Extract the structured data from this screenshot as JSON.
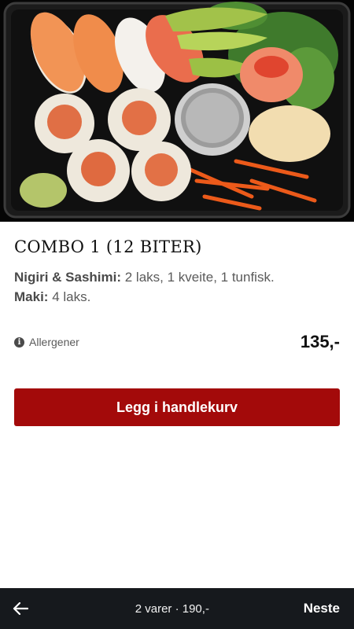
{
  "product": {
    "title": "COMBO 1 (12 BITER)",
    "desc": [
      {
        "label": "Nigiri & Sashimi:",
        "text": " 2 laks, 1 kveite, 1 tunfisk."
      },
      {
        "label": "Maki:",
        "text": " 4 laks."
      }
    ],
    "allergen_label": "Allergener",
    "price": "135,-"
  },
  "actions": {
    "add_to_cart": "Legg i handlekurv"
  },
  "bottom_bar": {
    "summary": "2 varer · 190,-",
    "next": "Neste"
  },
  "icons": {
    "info": "info-icon",
    "back": "arrow-left-icon"
  },
  "colors": {
    "accent": "#a30a0a",
    "bottom_bar": "#16191d"
  }
}
